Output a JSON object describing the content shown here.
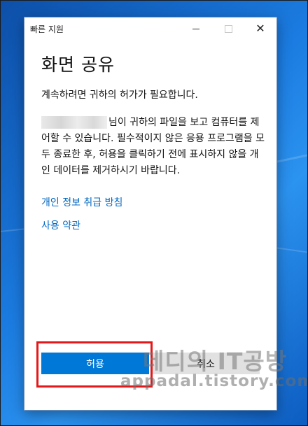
{
  "window": {
    "title": "빠른 지원",
    "close_glyph": "✕"
  },
  "content": {
    "heading": "화면 공유",
    "permission_text": "계속하려면 귀하의 허가가 필요합니다.",
    "description": "님이 귀하의 파일을 보고 컴퓨터를 제어할 수 있습니다. 필수적이지 않은 응용 프로그램을 모두 종료한 후, 허용을 클릭하기 전에 표시하지 않을 개인 데이터를 제거하시기 바랍니다.",
    "privacy_link": "개인 정보 취급 방침",
    "terms_link": "사용 약관"
  },
  "buttons": {
    "allow": "허용",
    "cancel": "취소"
  },
  "watermark": {
    "name": "데디의 IT공방",
    "url": "appadal.tistory.com"
  },
  "colors": {
    "accent": "#0078d7",
    "link": "#0067c0",
    "highlight": "#e41818"
  }
}
